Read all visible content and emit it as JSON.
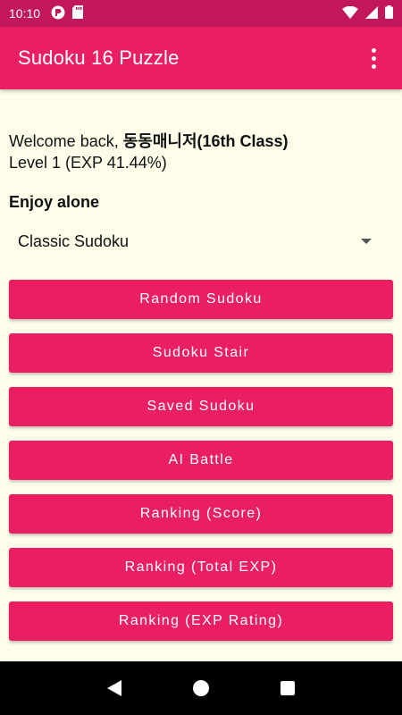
{
  "status_bar": {
    "time": "10:10",
    "icons_left": [
      "app-notification-icon",
      "sd-card-icon"
    ],
    "icons_right": [
      "wifi-icon",
      "signal-icon",
      "battery-icon"
    ]
  },
  "app_bar": {
    "title": "Sudoku 16 Puzzle",
    "menu_icon": "overflow-menu-icon"
  },
  "profile": {
    "welcome_prefix": "Welcome back, ",
    "username": "동동매니저(16th Class)",
    "level_text": "Level 1 (EXP 41.44%)"
  },
  "solo": {
    "section_title": "Enjoy alone",
    "selected_mode": "Classic Sudoku"
  },
  "buttons": [
    {
      "label": "Random Sudoku"
    },
    {
      "label": "Sudoku Stair"
    },
    {
      "label": "Saved Sudoku"
    },
    {
      "label": "AI Battle"
    },
    {
      "label": "Ranking (Score)"
    },
    {
      "label": "Ranking (Total EXP)"
    },
    {
      "label": "Ranking (EXP Rating)"
    }
  ],
  "colors": {
    "primary": "#e91e63",
    "status_bar": "#c2185b",
    "background": "#fdfdea",
    "nav_bar": "#000000"
  }
}
